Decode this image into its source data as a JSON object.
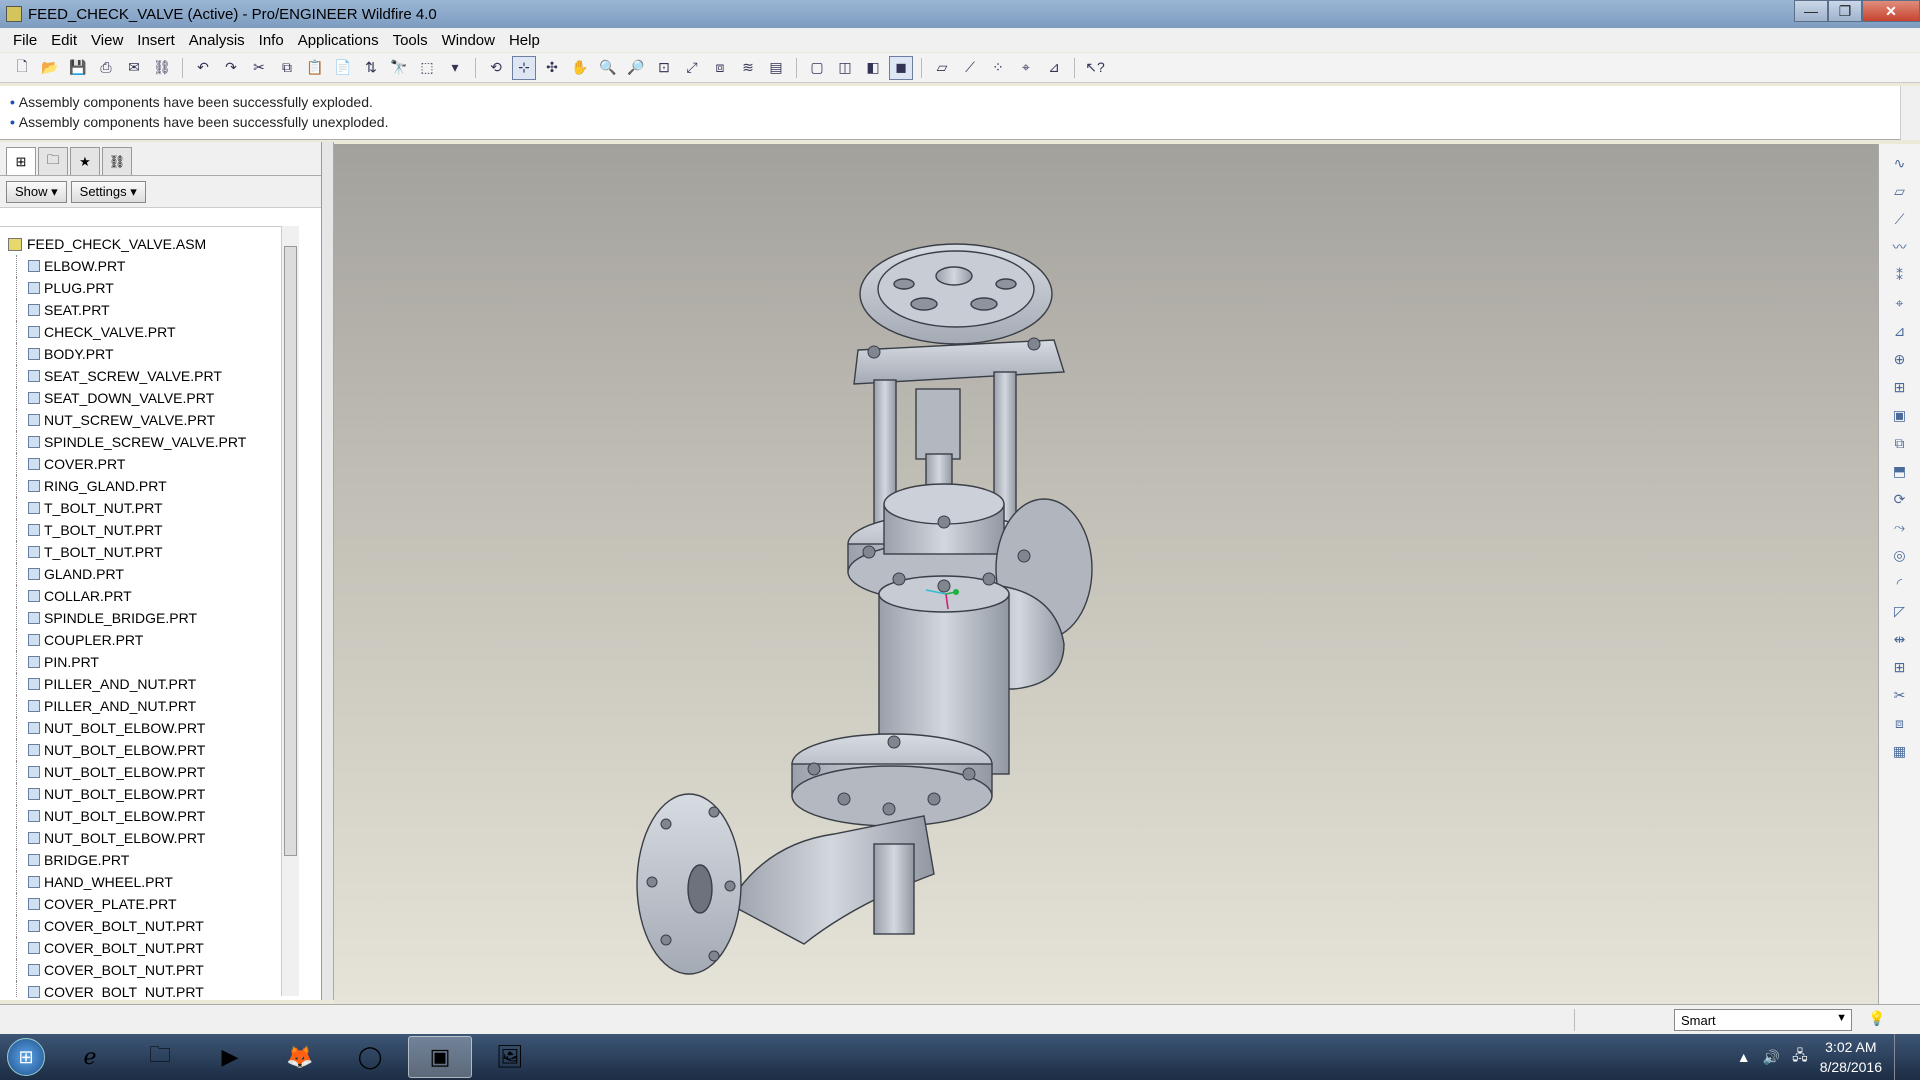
{
  "window": {
    "title": "FEED_CHECK_VALVE (Active) - Pro/ENGINEER Wildfire 4.0",
    "controls": [
      "—",
      "❐",
      "✕"
    ]
  },
  "menu": [
    "File",
    "Edit",
    "View",
    "Insert",
    "Analysis",
    "Info",
    "Applications",
    "Tools",
    "Window",
    "Help"
  ],
  "messages": [
    "Assembly components have been successfully exploded.",
    "Assembly components have been successfully unexploded."
  ],
  "panel": {
    "show_label": "Show ▾",
    "settings_label": "Settings ▾"
  },
  "tree": {
    "root": "FEED_CHECK_VALVE.ASM",
    "items": [
      "ELBOW.PRT",
      "PLUG.PRT",
      "SEAT.PRT",
      "CHECK_VALVE.PRT",
      "BODY.PRT",
      "SEAT_SCREW_VALVE.PRT",
      "SEAT_DOWN_VALVE.PRT",
      "NUT_SCREW_VALVE.PRT",
      "SPINDLE_SCREW_VALVE.PRT",
      "COVER.PRT",
      "RING_GLAND.PRT",
      "T_BOLT_NUT.PRT",
      "T_BOLT_NUT.PRT",
      "T_BOLT_NUT.PRT",
      "GLAND.PRT",
      "COLLAR.PRT",
      "SPINDLE_BRIDGE.PRT",
      "COUPLER.PRT",
      "PIN.PRT",
      "PILLER_AND_NUT.PRT",
      "PILLER_AND_NUT.PRT",
      "NUT_BOLT_ELBOW.PRT",
      "NUT_BOLT_ELBOW.PRT",
      "NUT_BOLT_ELBOW.PRT",
      "NUT_BOLT_ELBOW.PRT",
      "NUT_BOLT_ELBOW.PRT",
      "NUT_BOLT_ELBOW.PRT",
      "BRIDGE.PRT",
      "HAND_WHEEL.PRT",
      "COVER_PLATE.PRT",
      "COVER_BOLT_NUT.PRT",
      "COVER_BOLT_NUT.PRT",
      "COVER_BOLT_NUT.PRT",
      "COVER_BOLT_NUT.PRT"
    ]
  },
  "status": {
    "filter_value": "Smart"
  },
  "taskbar": {
    "time": "3:02 AM",
    "date": "8/28/2016"
  },
  "colors": {
    "viewport_top": "#a3a19c",
    "viewport_bottom": "#e6e4d8",
    "model_fill": "#c3c8d1",
    "model_edge": "#3a3e46"
  }
}
